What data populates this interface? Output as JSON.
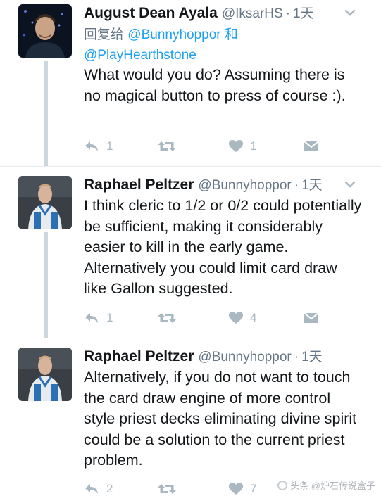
{
  "tweets": [
    {
      "name": "August Dean Ayala",
      "handle": "@IksarHS",
      "time": "1天",
      "reply_label": "回复给",
      "reply_mention_1": "@Bunnyhoppor",
      "reply_conj": "和",
      "reply_mention_2": "@PlayHearthstone",
      "text": "What would you do? Assuming there is no magical button to press of course :).",
      "reply_count": "1",
      "retweet_count": "",
      "like_count": "1"
    },
    {
      "name": "Raphael Peltzer",
      "handle": "@Bunnyhoppor",
      "time": "1天",
      "text": "I think cleric to 1/2 or 0/2 could potentially be sufficient, making it considerably easier to kill in the early game. Alternatively you could limit card draw like Gallon suggested.",
      "reply_count": "1",
      "retweet_count": "",
      "like_count": "4"
    },
    {
      "name": "Raphael Peltzer",
      "handle": "@Bunnyhoppor",
      "time": "1天",
      "text": "Alternatively, if you do not want to touch the card draw engine of more control style priest decks eliminating divine spirit could be a solution to the current priest problem.",
      "reply_count": "2",
      "retweet_count": "",
      "like_count": "7"
    }
  ],
  "separator": "·",
  "watermark": "头条 @炉石传说盒子",
  "colors": {
    "name": "#14171a",
    "meta": "#657786",
    "link": "#1da1f2",
    "action_icon": "#aab8c2",
    "thread_line": "#ccd6dd"
  }
}
